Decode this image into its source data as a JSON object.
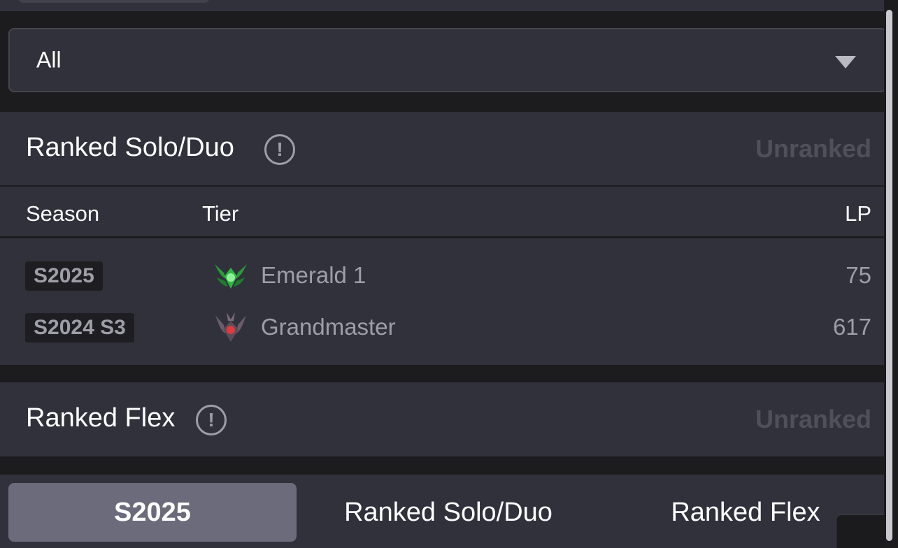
{
  "filter": {
    "selected": "All"
  },
  "ranked_solo": {
    "title": "Ranked Solo/Duo",
    "status": "Unranked",
    "columns": {
      "season": "Season",
      "tier": "Tier",
      "lp": "LP"
    },
    "rows": [
      {
        "season": "S2025",
        "tier": "Emerald 1",
        "lp": "75",
        "emblem": "emerald-emblem-icon",
        "emblem_color": "#2fb842"
      },
      {
        "season": "S2024 S3",
        "tier": "Grandmaster",
        "lp": "617",
        "emblem": "grandmaster-emblem-icon",
        "emblem_color": "#e03a3e"
      }
    ]
  },
  "ranked_flex": {
    "title": "Ranked Flex",
    "status": "Unranked"
  },
  "tabs": [
    {
      "label": "S2025",
      "active": true
    },
    {
      "label": "Ranked Solo/Duo",
      "active": false
    },
    {
      "label": "Ranked Flex",
      "active": false
    }
  ],
  "icons": {
    "info": "info-icon",
    "dropdown": "chevron-down-icon"
  },
  "colors": {
    "panel": "#31313c",
    "background": "#1c1c1f",
    "active_tab": "#6b6b7b",
    "muted_text": "#9e9ea8",
    "unranked_text": "#50505b"
  }
}
